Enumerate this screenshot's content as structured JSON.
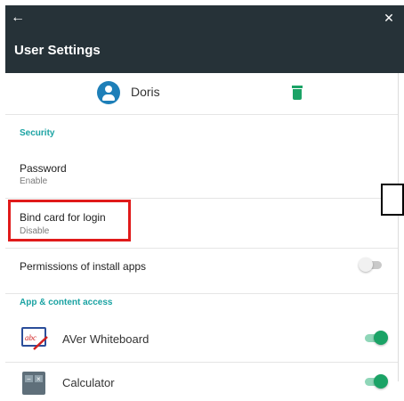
{
  "appbar": {
    "back_icon": "arrow-left-icon",
    "close_icon": "close-icon",
    "title": "User Settings",
    "bg_color": "#263238"
  },
  "user": {
    "name": "Doris",
    "avatar_icon": "account-circle-icon",
    "delete_icon": "trash-icon"
  },
  "security": {
    "header": "Security",
    "items": [
      {
        "label": "Password",
        "status": "Enable"
      },
      {
        "label": "Bind card for login",
        "status": "Disable"
      },
      {
        "label": "Permissions of install apps",
        "toggle": false
      }
    ]
  },
  "app_access": {
    "header": "App & content access",
    "items": [
      {
        "label": "AVer Whiteboard",
        "icon": "whiteboard-app-icon",
        "icon_text": "abc",
        "toggle": true
      },
      {
        "label": "Calculator",
        "icon": "calculator-app-icon",
        "toggle": true
      }
    ]
  },
  "colors": {
    "accent": "#1ba366",
    "section": "#1ba3a3",
    "highlight": "#e01a1a"
  }
}
